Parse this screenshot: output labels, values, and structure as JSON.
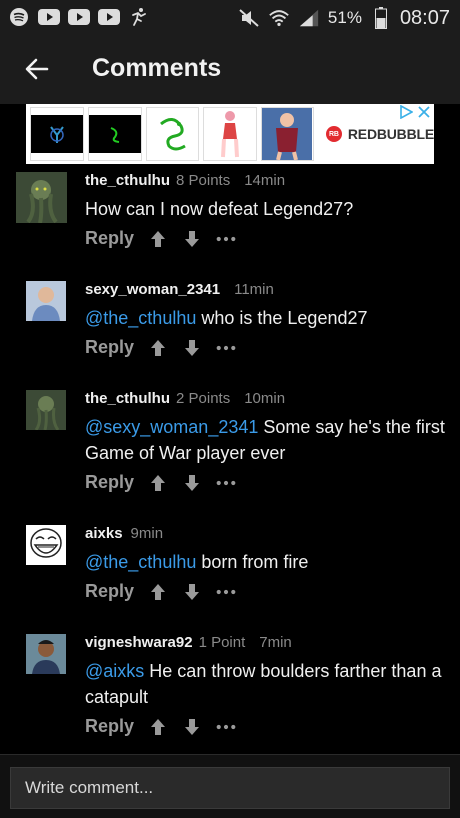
{
  "status_bar": {
    "battery": "51%",
    "time": "08:07"
  },
  "app_bar": {
    "title": "Comments"
  },
  "ad": {
    "brand": "REDBUBBLE",
    "badge": "RB"
  },
  "comments": [
    {
      "username": "the_cthulhu",
      "points": "8 Points",
      "time": "14min",
      "mention": "",
      "text": "How can I now defeat Legend27?",
      "reply_label": "Reply"
    },
    {
      "username": "sexy_woman_2341",
      "points": "",
      "time": "11min",
      "mention": "@the_cthulhu",
      "text": " who is the Legend27",
      "reply_label": "Reply"
    },
    {
      "username": "the_cthulhu",
      "points": "2 Points",
      "time": "10min",
      "mention": "@sexy_woman_2341",
      "text": " Some say he's the first Game of War player ever",
      "reply_label": "Reply"
    },
    {
      "username": "aixks",
      "points": "",
      "time": "9min",
      "mention": "@the_cthulhu",
      "text": " born from fire",
      "reply_label": "Reply"
    },
    {
      "username": "vigneshwara92",
      "points": "1 Point",
      "time": "7min",
      "mention": "@aixks",
      "text": " He can throw boulders farther than a catapult",
      "reply_label": "Reply"
    }
  ],
  "composer": {
    "placeholder": "Write comment..."
  }
}
